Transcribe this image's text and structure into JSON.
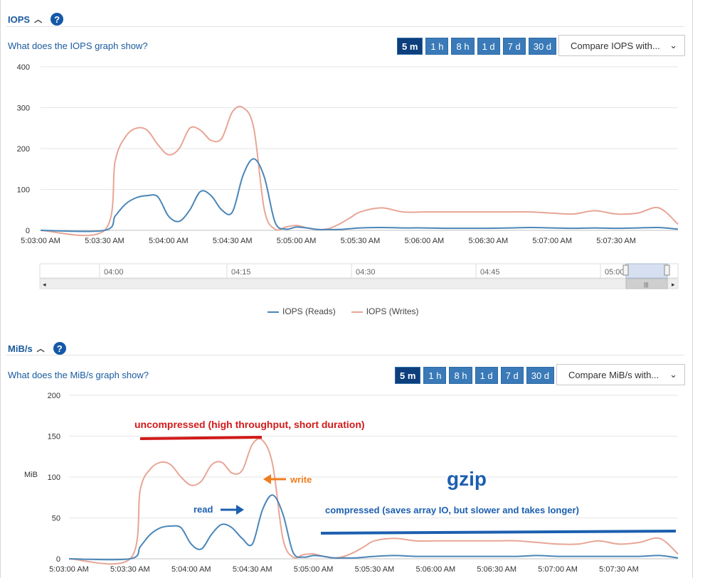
{
  "iops": {
    "title": "IOPS",
    "help_label": "?",
    "question": "What does the IOPS graph show?",
    "ranges": [
      "5 m",
      "1 h",
      "8 h",
      "1 d",
      "7 d",
      "30 d"
    ],
    "active_range": "5 m",
    "compare_label": "Compare IOPS with...",
    "navigator_ticks": [
      "04:00",
      "04:15",
      "04:30",
      "04:45",
      "05:00"
    ],
    "legend": [
      "IOPS (Reads)",
      "IOPS (Writes)"
    ]
  },
  "mibs": {
    "title": "MiB/s",
    "help_label": "?",
    "question": "What does the MiB/s graph show?",
    "ranges": [
      "5 m",
      "1 h",
      "8 h",
      "1 d",
      "7 d",
      "30 d"
    ],
    "active_range": "5 m",
    "compare_label": "Compare MiB/s with...",
    "annotations": {
      "uncompressed": "uncompressed (high throughput, short duration)",
      "write": "write",
      "read": "read",
      "gzip": "gzip",
      "compressed": "compressed (saves array IO, but slower and takes longer)"
    }
  },
  "colors": {
    "reads": "#4a86b8",
    "writes": "#e8a596",
    "link": "#1a5a9e",
    "button": "#3a7ab8",
    "button_active": "#0c3f7c",
    "annot_red": "#d11a1a",
    "annot_orange": "#f07c1e",
    "annot_blue": "#1c5fb0"
  },
  "chart_data": [
    {
      "type": "line",
      "title": "",
      "xlabel": "",
      "ylabel": "",
      "ylim": [
        0,
        400
      ],
      "yticks": [
        0,
        100,
        200,
        300,
        400
      ],
      "xticks": [
        "5:03:00 AM",
        "5:03:30 AM",
        "5:04:00 AM",
        "5:04:30 AM",
        "5:05:00 AM",
        "5:05:30 AM",
        "5:06:00 AM",
        "5:06:30 AM",
        "5:07:00 AM",
        "5:07:30 AM"
      ],
      "x_seconds": [
        0,
        30,
        35,
        40,
        45,
        50,
        55,
        60,
        65,
        70,
        75,
        80,
        85,
        90,
        95,
        100,
        105,
        110,
        115,
        120,
        125,
        130,
        135,
        140,
        145,
        150,
        160,
        170,
        180,
        190,
        200,
        210,
        220,
        230,
        240,
        250,
        260,
        270,
        280,
        290,
        299
      ],
      "series": [
        {
          "name": "IOPS (Reads)",
          "values": [
            0,
            0,
            35,
            65,
            80,
            85,
            82,
            35,
            22,
            50,
            95,
            85,
            50,
            45,
            135,
            175,
            130,
            20,
            3,
            8,
            6,
            2,
            2,
            2,
            4,
            6,
            7,
            6,
            6,
            5,
            5,
            5,
            6,
            7,
            6,
            5,
            6,
            5,
            6,
            7,
            3
          ]
        },
        {
          "name": "IOPS (Writes)",
          "values": [
            0,
            0,
            170,
            230,
            250,
            245,
            210,
            185,
            200,
            250,
            245,
            220,
            225,
            290,
            300,
            250,
            50,
            3,
            8,
            12,
            6,
            2,
            4,
            15,
            30,
            45,
            55,
            45,
            45,
            45,
            45,
            45,
            45,
            45,
            42,
            40,
            48,
            40,
            42,
            55,
            15
          ]
        }
      ],
      "grid": true
    },
    {
      "type": "line",
      "title": "",
      "xlabel": "",
      "ylabel": "MiB",
      "ylim": [
        0,
        200
      ],
      "yticks": [
        0,
        50,
        100,
        150,
        200
      ],
      "xticks": [
        "5:03:00 AM",
        "5:03:30 AM",
        "5:04:00 AM",
        "5:04:30 AM",
        "5:05:00 AM",
        "5:05:30 AM",
        "5:06:00 AM",
        "5:06:30 AM",
        "5:07:00 AM",
        "5:07:30 AM"
      ],
      "x_seconds": [
        0,
        30,
        35,
        40,
        45,
        50,
        55,
        60,
        65,
        70,
        75,
        80,
        85,
        90,
        95,
        100,
        105,
        110,
        115,
        120,
        125,
        130,
        135,
        140,
        145,
        150,
        160,
        170,
        180,
        190,
        200,
        210,
        220,
        230,
        240,
        250,
        260,
        270,
        280,
        290,
        299
      ],
      "series": [
        {
          "name": "read",
          "values": [
            0,
            0,
            15,
            30,
            38,
            40,
            38,
            18,
            12,
            30,
            42,
            38,
            25,
            18,
            60,
            78,
            55,
            8,
            2,
            4,
            3,
            1,
            1,
            1,
            2,
            3,
            4,
            3,
            3,
            3,
            3,
            3,
            3,
            4,
            3,
            3,
            3,
            3,
            3,
            4,
            1
          ]
        },
        {
          "name": "write",
          "values": [
            0,
            0,
            85,
            110,
            118,
            115,
            100,
            90,
            95,
            115,
            118,
            105,
            108,
            140,
            145,
            115,
            25,
            2,
            5,
            6,
            3,
            1,
            3,
            8,
            15,
            22,
            25,
            22,
            22,
            22,
            22,
            22,
            22,
            20,
            18,
            18,
            22,
            18,
            20,
            25,
            6
          ]
        }
      ],
      "grid": true
    }
  ]
}
